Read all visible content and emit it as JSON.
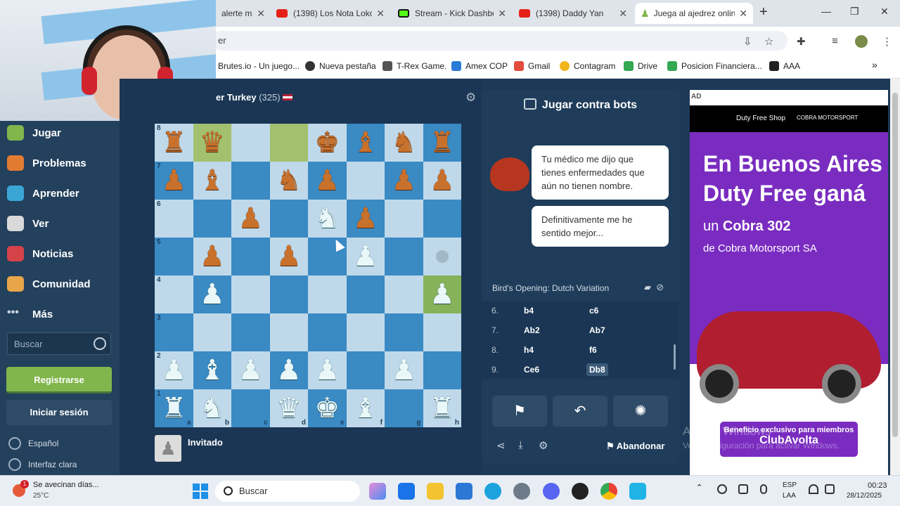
{
  "browser": {
    "tabs": [
      {
        "label": "alerte m",
        "icon": "pawn-icon"
      },
      {
        "label": "(1398) Los Nota Loko",
        "icon": "youtube-icon"
      },
      {
        "label": "Stream - Kick Dashbo",
        "icon": "kick-icon"
      },
      {
        "label": "(1398) Daddy Yan",
        "icon": "youtube-icon"
      },
      {
        "label": "Juega al ajedrez onlin",
        "icon": "pawn-icon",
        "active": true
      }
    ],
    "address_fragment": "er",
    "bookmarks": [
      "Brutes.io - Un juego...",
      "Nueva pestaña",
      "T-Rex Game.",
      "Amex COP",
      "Gmail",
      "Contagram",
      "Drive",
      "Posicion Financiera...",
      "AAA"
    ]
  },
  "nav": {
    "items": [
      "Jugar",
      "Problemas",
      "Aprender",
      "Ver",
      "Noticias",
      "Comunidad",
      "Más"
    ],
    "search_placeholder": "Buscar",
    "register": "Registrarse",
    "login": "Iniciar sesión",
    "language": "Español",
    "theme": "Interfaz clara"
  },
  "game": {
    "opponent_name": "er Turkey",
    "opponent_rating": "(325)",
    "player_name": "Invitado",
    "board": [
      [
        "bR",
        "bQ",
        "",
        "",
        "bK",
        "bB",
        "bN",
        "bR"
      ],
      [
        "bP",
        "bB",
        "",
        "bN",
        "bP",
        "",
        "bP",
        "bP"
      ],
      [
        "",
        "",
        "bP",
        "",
        "wN",
        "bP",
        "",
        ""
      ],
      [
        "",
        "bP",
        "",
        "bP",
        "",
        "wP",
        "",
        ""
      ],
      [
        "",
        "wP",
        "",
        "",
        "",
        "",
        "",
        "wP"
      ],
      [
        "",
        "",
        "",
        "",
        "",
        "",
        "",
        ""
      ],
      [
        "wP",
        "wB",
        "wP",
        "wP",
        "wP",
        "",
        "wP",
        ""
      ],
      [
        "wR",
        "wN",
        "",
        "wQ",
        "wK",
        "wB",
        "",
        "wR"
      ]
    ],
    "files": [
      "a",
      "b",
      "c",
      "d",
      "e",
      "f",
      "g",
      "h"
    ],
    "ranks": [
      "8",
      "7",
      "6",
      "5",
      "4",
      "3",
      "2",
      "1"
    ],
    "hint_square": "h5"
  },
  "panel": {
    "title": "Jugar contra bots",
    "bubble1": "Tu médico me dijo que tienes enfermedades que aún no tienen nombre.",
    "bubble2": "Definitivamente me he sentido mejor...",
    "opening": "Bird's Opening: Dutch Variation",
    "moves": [
      {
        "num": "6.",
        "white": "b4",
        "black": "c6"
      },
      {
        "num": "7.",
        "white": "Ab2",
        "black": "Ab7"
      },
      {
        "num": "8.",
        "white": "h4",
        "black": "f6"
      },
      {
        "num": "9.",
        "white": "Ce6",
        "black": "Db8"
      }
    ],
    "resign": "Abandonar"
  },
  "ad": {
    "label": "AD",
    "logo1": "Duty Free Shop",
    "logo2": "COBRA MOTORSPORT",
    "headline": "En Buenos Aires Duty Free ganá",
    "line2_prefix": "un",
    "line2_bold": "Cobra 302",
    "line3": "de Cobra Motorsport SA",
    "badge1": "Beneficio exclusivo para miembros",
    "badge2": "ClubAvolta"
  },
  "watermark": {
    "line1": "Activar Windows",
    "line2": "Ve a Configuración para activar Windows."
  },
  "taskbar": {
    "weather_text": "Se avecinan días...",
    "temperature": "25°C",
    "weather_badge": "1",
    "search": "Buscar",
    "lang1": "ESP",
    "lang2": "LAA",
    "time": "00:23",
    "date": "28/12/2025"
  }
}
